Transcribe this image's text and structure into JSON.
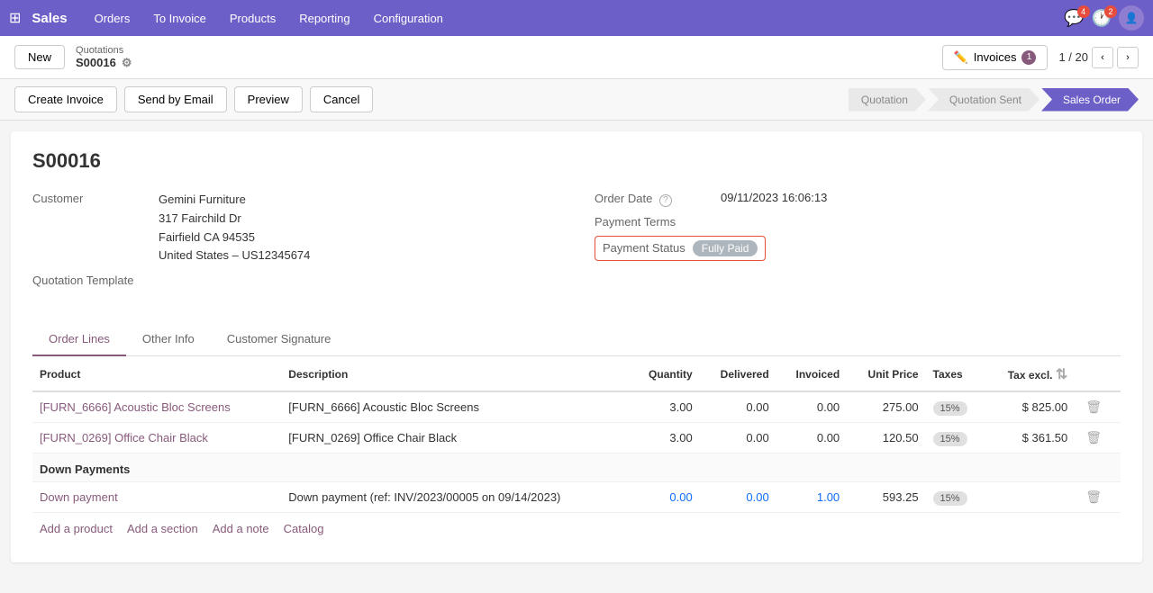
{
  "topnav": {
    "app_name": "Sales",
    "menu_items": [
      "Orders",
      "To Invoice",
      "Products",
      "Reporting",
      "Configuration"
    ],
    "messages_count": "4",
    "activities_count": "2"
  },
  "subheader": {
    "new_label": "New",
    "breadcrumb_parent": "Quotations",
    "breadcrumb_current": "S00016",
    "invoices_label": "Invoices",
    "invoices_count": "1",
    "pagination": "1 / 20"
  },
  "action_bar": {
    "create_invoice": "Create Invoice",
    "send_by_email": "Send by Email",
    "preview": "Preview",
    "cancel": "Cancel",
    "status_steps": [
      "Quotation",
      "Quotation Sent",
      "Sales Order"
    ]
  },
  "order": {
    "title": "S00016",
    "customer_label": "Customer",
    "customer_name": "Gemini Furniture",
    "customer_address": "317 Fairchild Dr",
    "customer_city": "Fairfield CA 94535",
    "customer_country": "United States – US12345674",
    "quotation_template_label": "Quotation Template",
    "order_date_label": "Order Date",
    "order_date_value": "09/11/2023 16:06:13",
    "payment_terms_label": "Payment Terms",
    "payment_status_label": "Payment Status",
    "fully_paid_label": "Fully Paid"
  },
  "tabs": [
    {
      "id": "order-lines",
      "label": "Order Lines",
      "active": true
    },
    {
      "id": "other-info",
      "label": "Other Info",
      "active": false
    },
    {
      "id": "customer-signature",
      "label": "Customer Signature",
      "active": false
    }
  ],
  "table": {
    "columns": [
      "Product",
      "Description",
      "Quantity",
      "Delivered",
      "Invoiced",
      "Unit Price",
      "Taxes",
      "Tax excl."
    ],
    "rows": [
      {
        "product": "[FURN_6666] Acoustic Bloc Screens",
        "description": "[FURN_6666] Acoustic Bloc Screens",
        "quantity": "3.00",
        "delivered": "0.00",
        "invoiced": "0.00",
        "unit_price": "275.00",
        "taxes": "15%",
        "tax_excl": "$ 825.00"
      },
      {
        "product": "[FURN_0269] Office Chair Black",
        "description": "[FURN_0269] Office Chair Black",
        "quantity": "3.00",
        "delivered": "0.00",
        "invoiced": "0.00",
        "unit_price": "120.50",
        "taxes": "15%",
        "tax_excl": "$ 361.50"
      }
    ],
    "down_payments_label": "Down Payments",
    "down_payment_row": {
      "product": "Down payment",
      "description": "Down payment (ref: INV/2023/00005 on 09/14/2023)",
      "quantity": "0.00",
      "delivered": "0.00",
      "invoiced": "1.00",
      "unit_price": "593.25",
      "taxes": "15%",
      "tax_excl": ""
    },
    "add_row": {
      "add_product": "Add a product",
      "add_section": "Add a section",
      "add_note": "Add a note",
      "catalog": "Catalog"
    }
  }
}
